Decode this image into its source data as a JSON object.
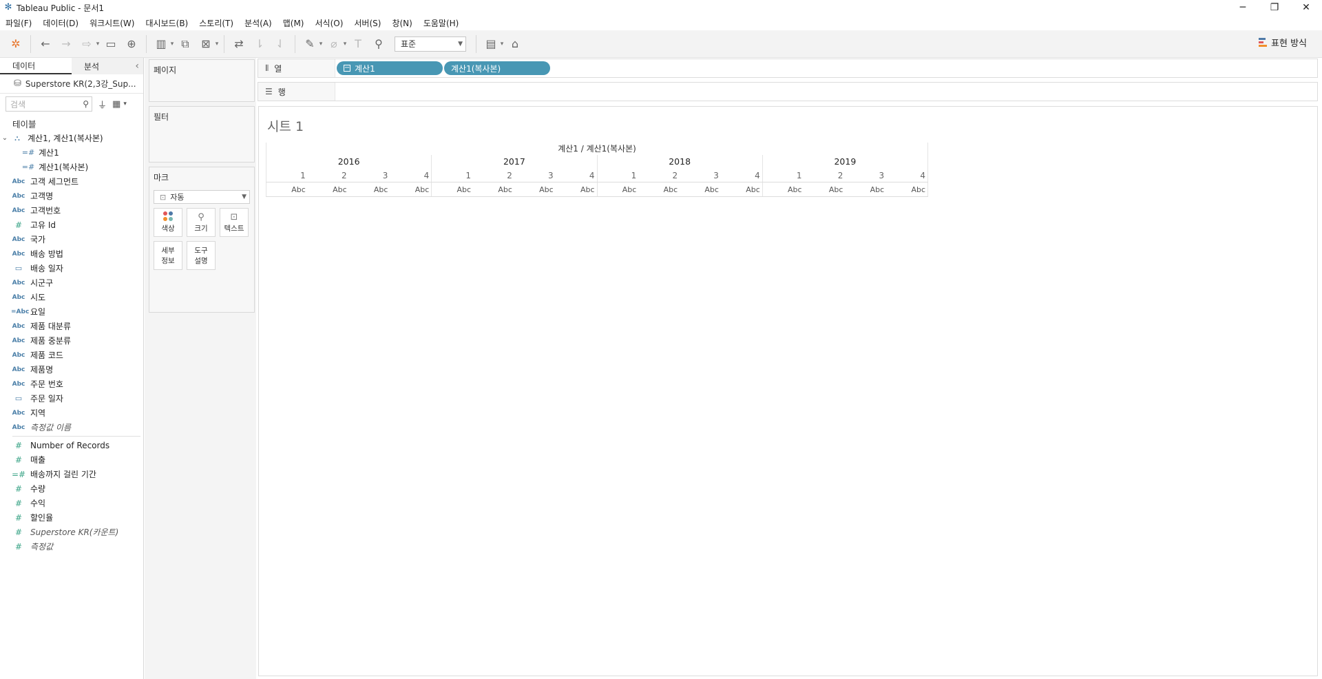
{
  "window": {
    "title": "Tableau Public - 문서1"
  },
  "menu": [
    "파일(F)",
    "데이터(D)",
    "워크시트(W)",
    "대시보드(B)",
    "스토리(T)",
    "분석(A)",
    "맵(M)",
    "서식(O)",
    "서버(S)",
    "창(N)",
    "도움말(H)"
  ],
  "toolbar": {
    "fit_value": "표준",
    "show_me": "표현 방식",
    "accent_colors": [
      "#4e79a7",
      "#e15759",
      "#f28e2b",
      "#59a14f"
    ]
  },
  "data_pane": {
    "tab_data": "데이터",
    "tab_analytics": "분석",
    "source": "Superstore KR(2,3강_Sup...",
    "search_placeholder": "검색",
    "tables_heading": "테이블",
    "group": {
      "label": "계산1, 계산1(복사본)",
      "children": [
        "계산1",
        "계산1(복사본)"
      ]
    },
    "dimensions": [
      {
        "icon": "Abc",
        "label": "고객 세그먼트"
      },
      {
        "icon": "Abc",
        "label": "고객명"
      },
      {
        "icon": "Abc",
        "label": "고객번호"
      },
      {
        "icon": "#",
        "label": "고유 Id"
      },
      {
        "icon": "Abc",
        "label": "국가"
      },
      {
        "icon": "Abc",
        "label": "배송 방법"
      },
      {
        "icon": "date",
        "label": "배송 일자"
      },
      {
        "icon": "Abc",
        "label": "시군구"
      },
      {
        "icon": "Abc",
        "label": "시도"
      },
      {
        "icon": "=Abc",
        "label": "요일"
      },
      {
        "icon": "Abc",
        "label": "제품 대분류"
      },
      {
        "icon": "Abc",
        "label": "제품 중분류"
      },
      {
        "icon": "Abc",
        "label": "제품 코드"
      },
      {
        "icon": "Abc",
        "label": "제품명"
      },
      {
        "icon": "Abc",
        "label": "주문 번호"
      },
      {
        "icon": "date",
        "label": "주문 일자"
      },
      {
        "icon": "Abc",
        "label": "지역"
      },
      {
        "icon": "Abc",
        "label": "측정값 이름"
      }
    ],
    "measures": [
      {
        "icon": "#",
        "label": "Number of Records"
      },
      {
        "icon": "#",
        "label": "매출"
      },
      {
        "icon": "=#",
        "label": "배송까지 걸린 기간"
      },
      {
        "icon": "#",
        "label": "수량"
      },
      {
        "icon": "#",
        "label": "수익"
      },
      {
        "icon": "#",
        "label": "할인율"
      },
      {
        "icon": "#",
        "label": "Superstore KR(카운트)"
      },
      {
        "icon": "#",
        "label": "측정값"
      }
    ]
  },
  "cards": {
    "pages": "페이지",
    "filters": "필터",
    "marks": "마크",
    "mark_type": "자동",
    "color": "색상",
    "size": "크기",
    "text": "텍스트",
    "detail_1": "세부",
    "detail_2": "정보",
    "tooltip_1": "도구",
    "tooltip_2": "설명"
  },
  "shelves": {
    "columns_label": "열",
    "rows_label": "행",
    "column_pills": [
      "계산1",
      "계산1(복사본)"
    ]
  },
  "sheet": {
    "title": "시트 1",
    "header_title": "계산1 / 계산1(복사본)",
    "years": [
      "2016",
      "2017",
      "2018",
      "2019"
    ],
    "quarters": [
      "1",
      "2",
      "3",
      "4"
    ],
    "cell_text": "Abc"
  }
}
